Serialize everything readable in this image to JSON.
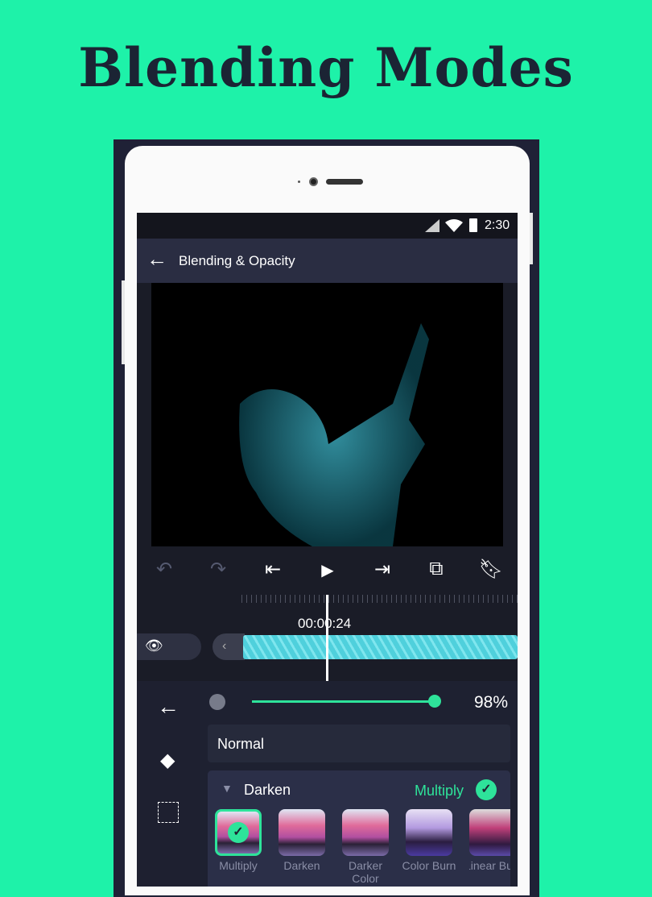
{
  "headline": "Blending Modes",
  "status": {
    "time": "2:30"
  },
  "appbar": {
    "title": "Blending & Opacity"
  },
  "timeline": {
    "timecode": "00:00:24"
  },
  "opacity": {
    "value_label": "98%",
    "value": 98
  },
  "blend": {
    "selected_mode": "Normal",
    "group": "Darken",
    "group_selected": "Multiply",
    "modes": [
      {
        "label": "Multiply",
        "selected": true
      },
      {
        "label": "Darken"
      },
      {
        "label": "Darker Color"
      },
      {
        "label": "Color Burn"
      },
      {
        "label": "Linear Bu"
      }
    ]
  },
  "colors": {
    "accent": "#2ee39a",
    "background": "#1ef2a9",
    "panel": "#2a2d42"
  }
}
